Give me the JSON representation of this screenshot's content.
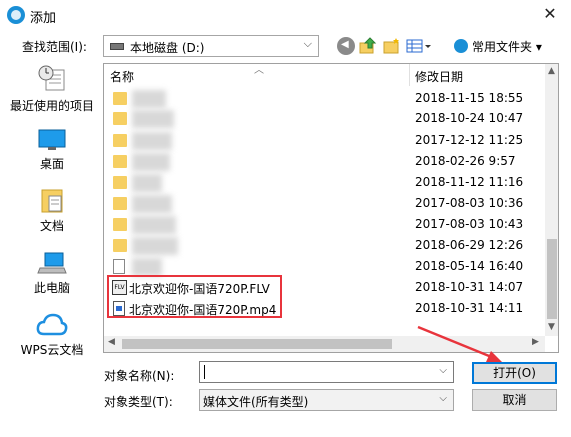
{
  "window": {
    "title": "添加",
    "close": "✕"
  },
  "toolbar": {
    "lookin_label": "查找范围(I):",
    "lookin_value": "本地磁盘 (D:)",
    "favorites_label": "常用文件夹 ▾"
  },
  "places": [
    {
      "label": "最近使用的项目",
      "icon": "recent-items-icon"
    },
    {
      "label": "桌面",
      "icon": "desktop-icon"
    },
    {
      "label": "文档",
      "icon": "documents-icon"
    },
    {
      "label": "此电脑",
      "icon": "this-pc-icon"
    },
    {
      "label": "WPS云文档",
      "icon": "wps-cloud-icon"
    }
  ],
  "columns": {
    "name": "名称",
    "date": "修改日期"
  },
  "rows": [
    {
      "type": "folder",
      "name": "",
      "date": "2018-11-15 18:55"
    },
    {
      "type": "folder",
      "name": "",
      "date": "2018-10-24 10:47"
    },
    {
      "type": "folder",
      "name": "",
      "date": "2017-12-12 11:25"
    },
    {
      "type": "folder",
      "name": "",
      "date": "2018-02-26 9:57"
    },
    {
      "type": "folder",
      "name": "",
      "date": "2018-11-12 11:16"
    },
    {
      "type": "folder",
      "name": "",
      "date": "2017-08-03 10:36"
    },
    {
      "type": "folder",
      "name": "",
      "date": "2017-08-03 10:43"
    },
    {
      "type": "folder",
      "name": "",
      "date": "2018-06-29 12:26"
    },
    {
      "type": "file",
      "name": "",
      "date": "2018-05-14 16:40"
    },
    {
      "type": "flv",
      "name": "北京欢迎你-国语720P.FLV",
      "date": "2018-10-31 14:07"
    },
    {
      "type": "mp4",
      "name": "北京欢迎你-国语720P.mp4",
      "date": "2018-10-31 14:11"
    }
  ],
  "filename": {
    "label": "对象名称(N):",
    "value": ""
  },
  "filetype": {
    "label": "对象类型(T):",
    "value": "媒体文件(所有类型)"
  },
  "buttons": {
    "open": "打开(O)",
    "cancel": "取消"
  },
  "colors": {
    "accent": "#0078d7",
    "highlight": "#e8343c",
    "folder": "#f6cf62"
  }
}
